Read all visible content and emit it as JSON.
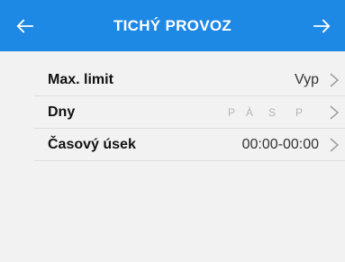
{
  "header": {
    "title": "TICHÝ PROVOZ",
    "back_icon": "arrow-left-icon",
    "forward_icon": "arrow-right-icon",
    "background": "#1e88e5"
  },
  "settings": {
    "max_limit": {
      "label": "Max. limit",
      "value": "Vyp"
    },
    "days": {
      "label": "Dny",
      "letters": [
        "P",
        "À",
        "S",
        "P"
      ]
    },
    "time_range": {
      "label": "Časový úsek",
      "value": "00:00-00:00"
    }
  }
}
